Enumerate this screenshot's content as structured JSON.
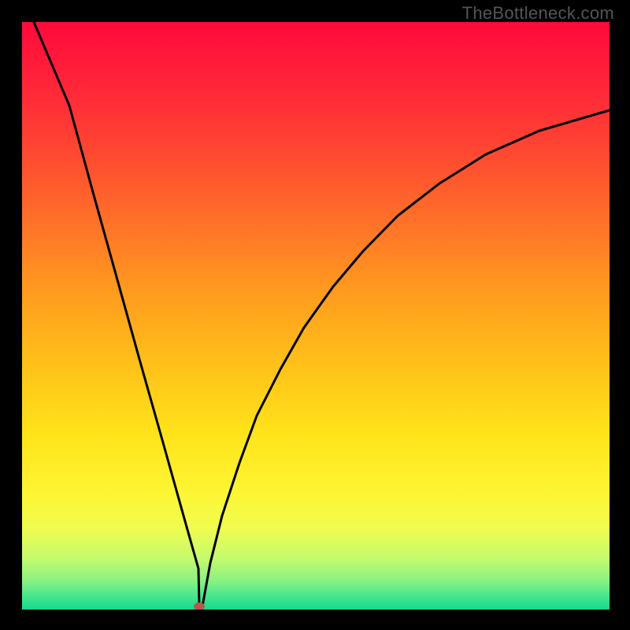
{
  "watermark": "TheBottleneck.com",
  "chart_data": {
    "type": "line",
    "title": "",
    "xlabel": "",
    "ylabel": "",
    "xlim": [
      0,
      100
    ],
    "ylim": [
      0,
      100
    ],
    "gradient_range": {
      "top_color": "#ff0a3b",
      "bottom_color": "#14d98f"
    },
    "marker": {
      "x_pct": 30,
      "y_pct": 0,
      "color": "#c05040"
    },
    "series": [
      {
        "name": "left-branch",
        "x": [
          2,
          6,
          10,
          14,
          18,
          22,
          26,
          28,
          30
        ],
        "values": [
          100,
          86,
          71,
          57,
          42.5,
          28.5,
          14,
          7,
          0
        ]
      },
      {
        "name": "right-branch",
        "x": [
          30,
          32,
          34,
          37,
          40,
          44,
          48,
          53,
          58,
          64,
          71,
          79,
          88,
          100
        ],
        "values": [
          0,
          8,
          16,
          25,
          33,
          41,
          48,
          55,
          61,
          67,
          72.5,
          77.5,
          81.5,
          85
        ]
      }
    ]
  }
}
